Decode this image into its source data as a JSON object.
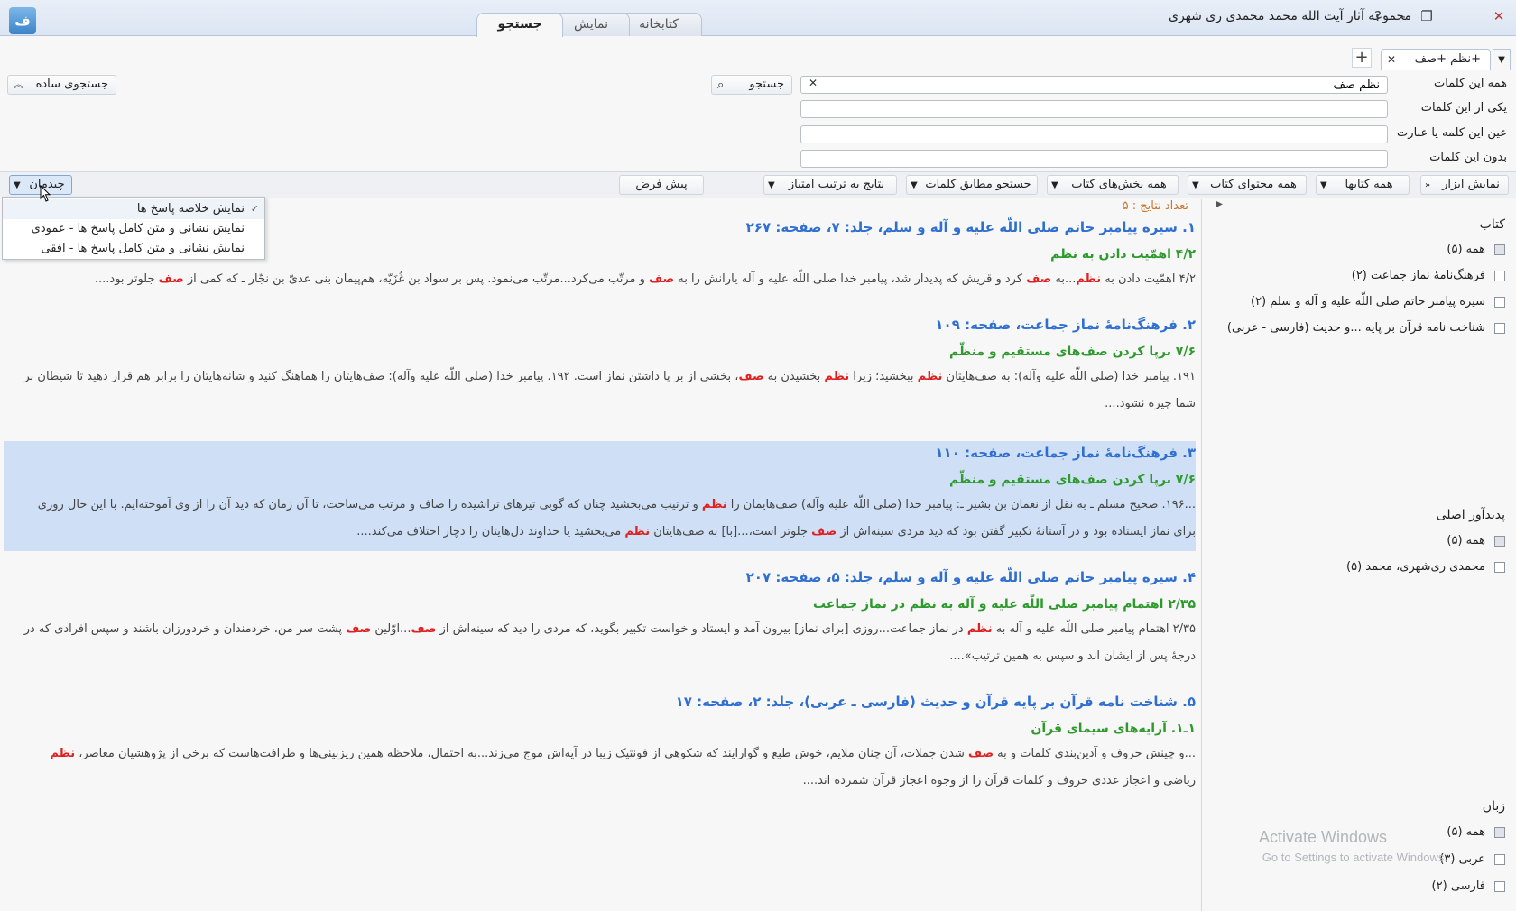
{
  "title_bar": {
    "app_title": "مجموعه آثار آیت الله محمد محمدی ری شهری",
    "tabs": [
      "کتابخانه",
      "نمایش",
      "جستجو"
    ],
    "active_tab": "جستجو"
  },
  "query_tabs": {
    "tab_label": "+نظم +صف",
    "add_label": "+"
  },
  "search_form": {
    "fields": [
      {
        "label": "همه این کلمات",
        "value": "نظم صف"
      },
      {
        "label": "یکی از این کلمات",
        "value": ""
      },
      {
        "label": "عین این کلمه یا عبارت",
        "value": ""
      },
      {
        "label": "بدون این کلمات",
        "value": ""
      }
    ],
    "search_label": "جستجو",
    "simple_search_label": "جستجوی ساده"
  },
  "toolbar": {
    "show_tools": "نمایش ابزار",
    "all_books": "همه کتابها",
    "all_book_content": "همه محتوای کتاب",
    "all_book_sections": "همه بخش‌های کتاب",
    "match_words": "جستجو مطابق کلمات",
    "sort_score": "نتایج به ترتیب امتیاز",
    "default": "پیش فرض",
    "layout": "چیدمان"
  },
  "layout_menu": {
    "items": [
      "نمایش خلاصه پاسخ ها",
      "نمایش نشانی و متن کامل پاسخ ها - عمودی",
      "نمایش نشانی و متن کامل پاسخ ها - افقی"
    ],
    "checked_index": 0
  },
  "results": {
    "count_label": "تعداد نتایج : ۵",
    "items": [
      {
        "title": "۱. سیره پیامبر خاتم صلی اللّه علیه و آله و سلم، جلد: ۷، صفحه: ۲۶۷",
        "section": "۴/۲ اهمّیت دادن به نظم",
        "lines": [
          [
            {
              "t": "۴/۲ اهمّیت دادن به "
            },
            {
              "t": "نظم",
              "h": true
            },
            {
              "t": "...به "
            },
            {
              "t": "صف",
              "h": true
            },
            {
              "t": " کرد و قریش که پدیدار شد، پیامبر خدا صلی اللّه علیه و آله یارانش را به "
            },
            {
              "t": "صف",
              "h": true
            },
            {
              "t": " و مرتّب می‌کرد...مرتّب می‌نمود. پس بر سواد بن غُزَیّه، هم‌پیمان بنی عدیّ بن نجّار ـ که کمی از "
            },
            {
              "t": "صف",
              "h": true
            },
            {
              "t": " جلوتر بود...."
            }
          ]
        ]
      },
      {
        "title": "۲. فرهنگ‌نامهٔ نماز جماعت، صفحه: ۱۰۹",
        "section": "۷/۶ برپا کردن صف‌های مستقیم و منظّم",
        "lines": [
          [
            {
              "t": "۱۹۱. پیامبر خدا (صلی اللّه علیه وآله): به صف‌هایتان "
            },
            {
              "t": "نظم",
              "h": true
            },
            {
              "t": " ببخشید؛ زیرا "
            },
            {
              "t": "نظم",
              "h": true
            },
            {
              "t": " بخشیدن به "
            },
            {
              "t": "صف",
              "h": true
            },
            {
              "t": "، بخشی از بر پا داشتن نماز است. ۱۹۲. پیامبر خدا (صلی اللّه علیه وآله): صف‌هایتان را هماهنگ کنید و شانه‌هایتان را برابر هم قرار دهید تا شیطان بر"
            }
          ],
          [
            {
              "t": "شما چیره نشود...."
            }
          ]
        ]
      },
      {
        "title": "۳. فرهنگ‌نامهٔ نماز جماعت، صفحه: ۱۱۰",
        "section": "۷/۶ برپا کردن صف‌های مستقیم و منظّم",
        "selected": true,
        "lines": [
          [
            {
              "t": "...۱۹۶. صحیح مسلم ـ به نقل از نعمان بن بشیر ـ: پیامبر خدا (صلی اللّه علیه وآله) صف‌هایمان را "
            },
            {
              "t": "نظم",
              "h": true
            },
            {
              "t": " و ترتیب می‌بخشید چنان که گویی تیرهای تراشیده را صاف و مرتب می‌ساخت، تا آن زمان که دید آن را از وی آموخته‌ایم. با این حال روزی"
            }
          ],
          [
            {
              "t": "برای نماز ایستاده بود و در آستانهٔ تکبیر گفتن بود که دید مردی سینه‌اش از "
            },
            {
              "t": "صف",
              "h": true
            },
            {
              "t": " جلوتر است،...[با] به صف‌هایتان "
            },
            {
              "t": "نظم",
              "h": true
            },
            {
              "t": " می‌بخشید یا خداوند دل‌هایتان را دچار اختلاف می‌کند...."
            }
          ]
        ]
      },
      {
        "title": "۴. سیره پیامبر خاتم صلی اللّه علیه و آله و سلم، جلد: ۵، صفحه: ۲۰۷",
        "section": "۲/۳۵ اهتمام پیامبر صلی اللّه علیه و آله به نظم در نماز جماعت",
        "lines": [
          [
            {
              "t": "۲/۳۵ اهتمام پیامبر صلی اللّه علیه و آله به "
            },
            {
              "t": "نظم",
              "h": true
            },
            {
              "t": " در نماز جماعت...روزی [برای نماز] بیرون آمد و ایستاد و خواست تکبیر بگوید، که مردی را دید که سینه‌اش از "
            },
            {
              "t": "صف",
              "h": true
            },
            {
              "t": "...اوّلین "
            },
            {
              "t": "صف",
              "h": true
            },
            {
              "t": " پشت سر من، خردمندان و خردورزان باشند و سپس افرادی که در"
            }
          ],
          [
            {
              "t": "درجهٔ پس از ایشان اند و سپس به همین ترتیب»...."
            }
          ]
        ]
      },
      {
        "title": "۵. شناخت نامه قرآن بر پایه قرآن و حدیث (فارسی ـ عربی)، جلد: ۲، صفحه: ۱۷",
        "section": "۱ـ۱. آرایه‌های سیمای قرآن",
        "lines": [
          [
            {
              "t": "...و چینش حروف و آذین‌بندی کلمات و به "
            },
            {
              "t": "صف",
              "h": true
            },
            {
              "t": " شدن جملات، آن چنان ملایم، خوش طبع و گوارایند که شکوهی از فونتیک زیبا در آیه‌اش موج می‌زند...به احتمال، ملاحظه همین ریزبینی‌ها و ظرافت‌هاست که برخی از پژوهشیان معاصر، "
            },
            {
              "t": "نظم",
              "h": true
            }
          ],
          [
            {
              "t": "ریاضی و اعجاز عددی حروف و کلمات قرآن را از وجوه اعجاز قرآن شمرده اند...."
            }
          ]
        ]
      }
    ]
  },
  "facets": {
    "book_heading": "کتاب",
    "book_items": [
      {
        "label": "همه (۵)",
        "checked": true
      },
      {
        "label": "فرهنگ‌نامهٔ نماز جماعت (۲)",
        "checked": false
      },
      {
        "label": "سیره پیامبر خاتم صلی اللّه علیه و آله و سلم (۲)",
        "checked": false
      },
      {
        "label": "شناخت نامه قرآن بر پایه ...و حدیث (فارسی - عربی)",
        "checked": false
      }
    ],
    "author_heading": "پدیدآور اصلی",
    "author_items": [
      {
        "label": "همه (۵)",
        "checked": true
      },
      {
        "label": "محمدی ری‌شهری، محمد (۵)",
        "checked": false
      }
    ],
    "language_heading": "زبان",
    "language_items": [
      {
        "label": "همه (۵)",
        "checked": true
      },
      {
        "label": "عربی (۳)",
        "checked": false
      },
      {
        "label": "فارسی (۲)",
        "checked": false
      }
    ]
  },
  "watermark": {
    "line1": "Activate Windows",
    "line2": "Go to Settings to activate Windows."
  }
}
